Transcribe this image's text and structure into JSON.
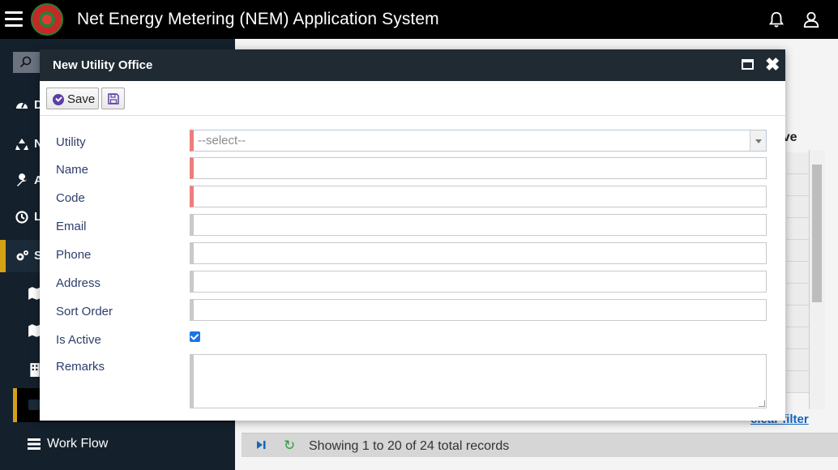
{
  "header": {
    "title": "Net Energy Metering (NEM) Application System"
  },
  "sidebar": {
    "items": [
      {
        "label": "D",
        "icon": "dashboard-icon"
      },
      {
        "label": "N",
        "icon": "recycle-icon"
      },
      {
        "label": "A",
        "icon": "wrench-icon"
      },
      {
        "label": "L",
        "icon": "history-icon"
      },
      {
        "label": "S",
        "icon": "cogs-icon"
      }
    ],
    "workflow_label": "Work Flow"
  },
  "content": {
    "column_header": "tive",
    "clear_filter_label": "clear filter",
    "pager_text": "Showing 1 to 20 of 24 total records"
  },
  "dialog": {
    "title": "New Utility Office",
    "save_label": "Save",
    "fields": {
      "utility_label": "Utility",
      "utility_placeholder": "--select--",
      "name_label": "Name",
      "code_label": "Code",
      "email_label": "Email",
      "phone_label": "Phone",
      "address_label": "Address",
      "sort_order_label": "Sort Order",
      "is_active_label": "Is Active",
      "remarks_label": "Remarks"
    },
    "is_active_checked": true
  },
  "colors": {
    "header_bg": "#000000",
    "sidebar_bg": "#14202c",
    "accent": "#d4a017",
    "required_marker": "#ee7d7d",
    "label_text": "#2c3e6a"
  }
}
